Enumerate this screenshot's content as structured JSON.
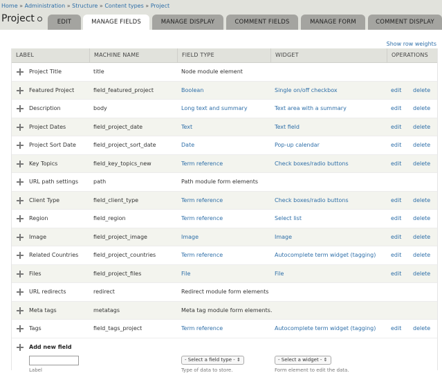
{
  "breadcrumb": [
    {
      "label": "Home"
    },
    {
      "label": "Administration"
    },
    {
      "label": "Structure"
    },
    {
      "label": "Content types"
    },
    {
      "label": "Project"
    }
  ],
  "page_title": "Project",
  "tabs": [
    {
      "label": "EDIT"
    },
    {
      "label": "MANAGE FIELDS"
    },
    {
      "label": "MANAGE DISPLAY"
    },
    {
      "label": "COMMENT FIELDS"
    },
    {
      "label": "MANAGE FORM"
    },
    {
      "label": "COMMENT DISPLAY"
    }
  ],
  "active_tab": "MANAGE FIELDS",
  "show_row_weights": "Show row weights",
  "columns": [
    "LABEL",
    "MACHINE NAME",
    "FIELD TYPE",
    "WIDGET",
    "OPERATIONS"
  ],
  "rows": [
    {
      "label": "Project Title",
      "machine": "title",
      "type": "Node module element",
      "widget": "",
      "edit": "",
      "delete": ""
    },
    {
      "label": "Featured Project",
      "machine": "field_featured_project",
      "type": "Boolean",
      "widget": "Single on/off checkbox",
      "edit": "edit",
      "delete": "delete"
    },
    {
      "label": "Description",
      "machine": "body",
      "type": "Long text and summary",
      "widget": "Text area with a summary",
      "edit": "edit",
      "delete": "delete"
    },
    {
      "label": "Project Dates",
      "machine": "field_project_date",
      "type": "Text",
      "widget": "Text field",
      "edit": "edit",
      "delete": "delete"
    },
    {
      "label": "Project Sort Date",
      "machine": "field_project_sort_date",
      "type": "Date",
      "widget": "Pop-up calendar",
      "edit": "edit",
      "delete": "delete"
    },
    {
      "label": "Key Topics",
      "machine": "field_key_topics_new",
      "type": "Term reference",
      "widget": "Check boxes/radio buttons",
      "edit": "edit",
      "delete": "delete"
    },
    {
      "label": "URL path settings",
      "machine": "path",
      "type": "Path module form elements",
      "widget": "",
      "edit": "",
      "delete": ""
    },
    {
      "label": "Client Type",
      "machine": "field_client_type",
      "type": "Term reference",
      "widget": "Check boxes/radio buttons",
      "edit": "edit",
      "delete": "delete"
    },
    {
      "label": "Region",
      "machine": "field_region",
      "type": "Term reference",
      "widget": "Select list",
      "edit": "edit",
      "delete": "delete"
    },
    {
      "label": "Image",
      "machine": "field_project_image",
      "type": "Image",
      "widget": "Image",
      "edit": "edit",
      "delete": "delete"
    },
    {
      "label": "Related Countries",
      "machine": "field_project_countries",
      "type": "Term reference",
      "widget": "Autocomplete term widget (tagging)",
      "edit": "edit",
      "delete": "delete"
    },
    {
      "label": "Files",
      "machine": "field_project_files",
      "type": "File",
      "widget": "File",
      "edit": "edit",
      "delete": "delete"
    },
    {
      "label": "URL redirects",
      "machine": "redirect",
      "type": "Redirect module form elements",
      "widget": "",
      "edit": "",
      "delete": ""
    },
    {
      "label": "Meta tags",
      "machine": "metatags",
      "type": "Meta tag module form elements.",
      "widget": "",
      "edit": "",
      "delete": ""
    },
    {
      "label": "Tags",
      "machine": "field_tags_project",
      "type": "Term reference",
      "widget": "Autocomplete term widget (tagging)",
      "edit": "edit",
      "delete": "delete"
    }
  ],
  "add_new": {
    "title": "Add new field",
    "field_type_select": "- Select a field type -",
    "widget_select": "- Select a widget -",
    "label_help": "Label",
    "type_help": "Type of data to store.",
    "widget_help": "Form element to edit the data."
  }
}
